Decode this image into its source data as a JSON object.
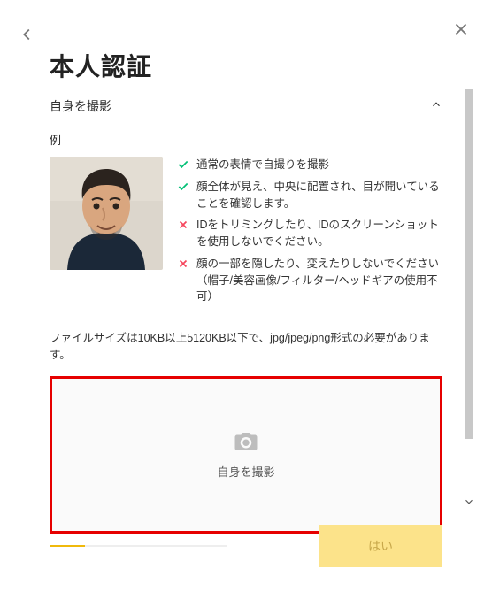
{
  "header": {
    "title": "本人認証",
    "section_label": "自身を撮影"
  },
  "example": {
    "label": "例"
  },
  "rules": [
    {
      "ok": true,
      "text": "通常の表情で自撮りを撮影"
    },
    {
      "ok": true,
      "text": "顔全体が見え、中央に配置され、目が開いていることを確認します。"
    },
    {
      "ok": false,
      "text": "IDをトリミングしたり、IDのスクリーンショットを使用しないでください。"
    },
    {
      "ok": false,
      "text": "顔の一部を隠したり、変えたりしないでください（帽子/美容画像/フィルター/ヘッドギアの使用不可）"
    }
  ],
  "filesize_note": "ファイルサイズは10KB以上5120KB以下で、jpg/jpeg/png形式の必要があります。",
  "upload": {
    "caption": "自身を撮影"
  },
  "footer": {
    "submit_label": "はい",
    "progress_pct": 20
  },
  "colors": {
    "accent": "#f0b90b",
    "error_border": "#e60000",
    "ok": "#02c076",
    "bad": "#f6465d"
  }
}
